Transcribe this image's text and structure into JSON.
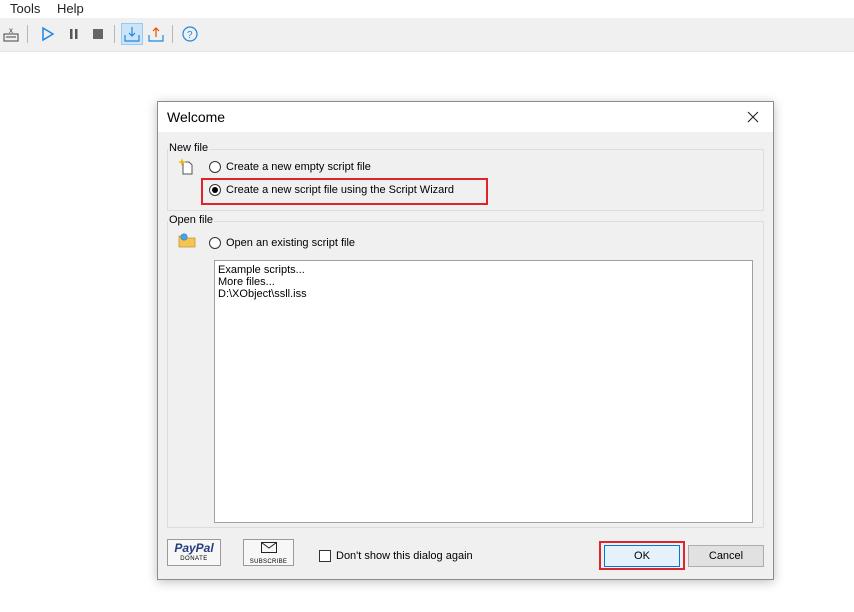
{
  "menubar": {
    "items": [
      "Tools",
      "Help"
    ]
  },
  "toolbar": {
    "icons": [
      "exit-icon",
      "play-icon",
      "pause-icon",
      "stop-icon",
      "install-icon",
      "upload-icon",
      "help-icon"
    ]
  },
  "dialog": {
    "title": "Welcome",
    "new_file": {
      "label": "New file",
      "option_empty": "Create a new empty script file",
      "option_wizard": "Create a new script file using the Script Wizard",
      "selected": "option_wizard"
    },
    "open_file": {
      "label": "Open file",
      "option_existing": "Open an existing script file",
      "list_items": [
        "Example scripts...",
        "More files...",
        "D:\\XObject\\ssll.iss"
      ]
    },
    "paypal": {
      "brand": "PayPal",
      "caption": "DONATE"
    },
    "subscribe": {
      "caption": "SUBSCRIBE"
    },
    "dont_show_label": "Don't show this dialog again",
    "ok_label": "OK",
    "cancel_label": "Cancel"
  },
  "colors": {
    "highlight": "#e0242b",
    "paypal_dark": "#253b80",
    "paypal_light": "#179bd7",
    "accent": "#0078d7"
  }
}
